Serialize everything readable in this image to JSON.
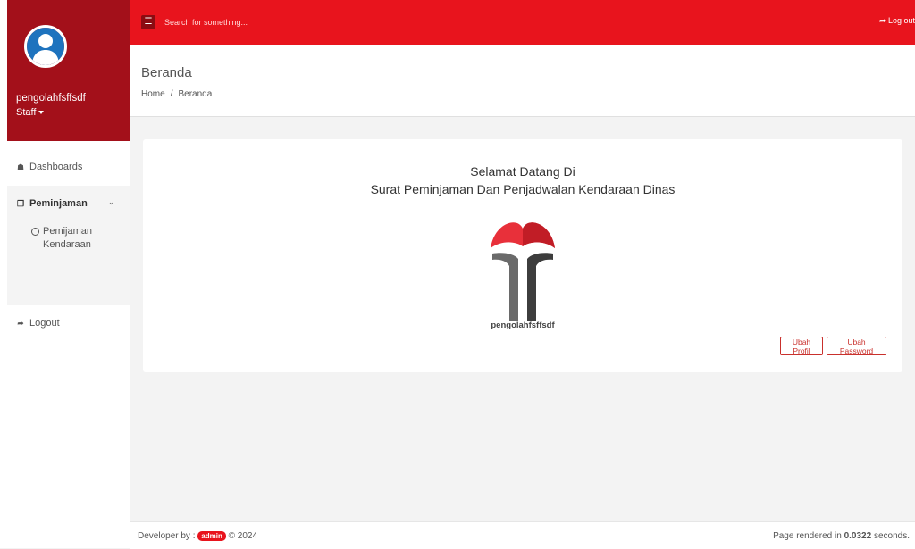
{
  "sidebar": {
    "user_name": "pengolahfsffsdf",
    "user_role": "Staff",
    "nav": {
      "dashboards": "Dashboards",
      "peminjaman": "Peminjaman",
      "sub_item": "Pemijaman Kendaraan",
      "logout": "Logout"
    }
  },
  "topbar": {
    "search_placeholder": "Search for something...",
    "logout_label": "Log out"
  },
  "header": {
    "title": "Beranda",
    "breadcrumb": [
      "Home",
      "Beranda"
    ]
  },
  "card": {
    "welcome_line1": "Selamat Datang Di",
    "welcome_line2": "Surat Peminjaman Dan Penjadwalan Kendaraan Dinas",
    "logo_caption": "pengolahfsffsdf",
    "btn_profil": "Ubah Profil",
    "btn_password": "Ubah Password"
  },
  "footer": {
    "developer_prefix": "Developer by :",
    "developer_badge": "admin",
    "copyright": "© 2024",
    "rendered_prefix": "Page rendered in",
    "rendered_time": "0.0322",
    "rendered_suffix": "seconds."
  },
  "colors": {
    "topbar": "#e8141d",
    "sidebar_header": "#a3101a",
    "button_outline": "#c9302c"
  },
  "icons": [
    "hamburger-icon",
    "logout-icon",
    "home-icon",
    "copy-icon",
    "chevron-down-icon",
    "circle-icon",
    "user-avatar-icon"
  ]
}
